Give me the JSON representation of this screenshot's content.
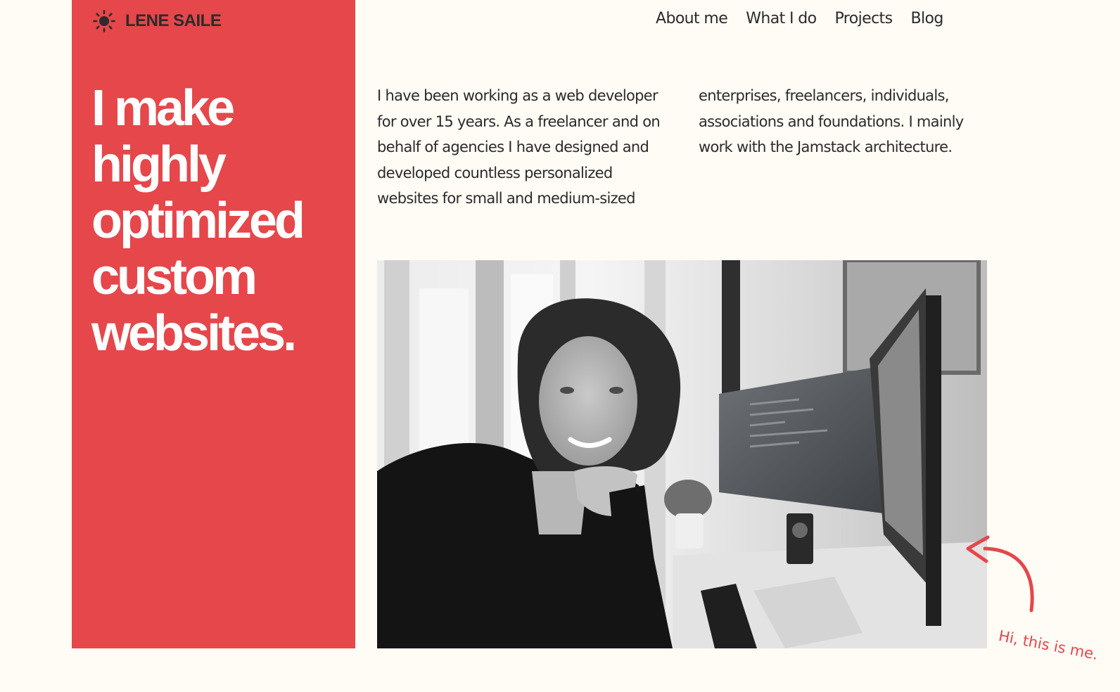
{
  "brand": {
    "name": "LENE SAILE",
    "icon": "sun-icon"
  },
  "nav": {
    "items": [
      "About me",
      "What I do",
      "Projects",
      "Blog"
    ]
  },
  "hero": {
    "headline": [
      "I make",
      "highly",
      "optimized",
      "custom",
      "websites."
    ]
  },
  "intro": {
    "text": "I have been working as a web developer for over 15 years. As a freelancer and on behalf of agencies I have designed and developed countless personalized websites for small and medium-sized enterprises, freelancers, individuals, associations and foundations. I mainly work with the Jamstack architecture."
  },
  "portrait": {
    "caption": "Hi, this is me."
  },
  "colors": {
    "accent": "#e5474b",
    "background": "#fffcf5",
    "text": "#2b2b2b",
    "headline": "#ffffff"
  }
}
